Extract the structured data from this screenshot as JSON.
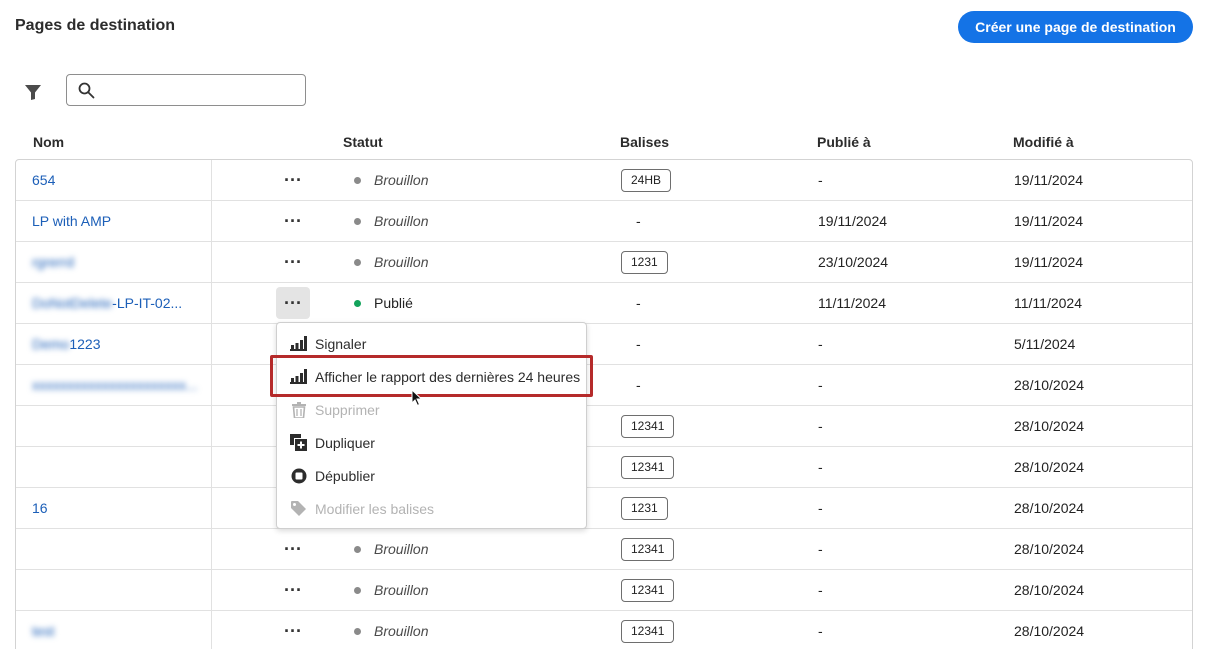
{
  "header": {
    "title": "Pages de destination",
    "create_label": "Créer une page de destination"
  },
  "toolbar": {
    "filter_icon": "filter-icon",
    "search_icon": "search-icon",
    "search_value": "",
    "search_placeholder": ""
  },
  "columns": {
    "name": "Nom",
    "status": "Statut",
    "tags": "Balises",
    "published": "Publié à",
    "modified": "Modifié à"
  },
  "rows": [
    {
      "name": "654",
      "name_suffix": "",
      "blurred": false,
      "status": "Brouillon",
      "tag": "24HB",
      "published": "-",
      "modified": "19/11/2024"
    },
    {
      "name": "LP with AMP",
      "name_suffix": "",
      "blurred": false,
      "status": "Brouillon",
      "tag": "-",
      "published": "19/11/2024",
      "modified": "19/11/2024"
    },
    {
      "name": "rgrerrd",
      "name_suffix": "",
      "blurred": true,
      "status": "Brouillon",
      "tag": "1231",
      "published": "23/10/2024",
      "modified": "19/11/2024"
    },
    {
      "name": "DoNotDelete",
      "name_suffix": "-LP-IT-02...",
      "blurred": true,
      "status": "Publié",
      "tag": "-",
      "published": "11/11/2024",
      "modified": "11/11/2024"
    },
    {
      "name": "Demo",
      "name_suffix": "1223",
      "blurred": true,
      "status": "",
      "tag": "-",
      "published": "-",
      "modified": "5/11/2024"
    },
    {
      "name": "xxxxxxxxxxxxxxxxxxxxxx...",
      "name_suffix": "",
      "blurred": true,
      "status": "",
      "tag": "-",
      "published": "-",
      "modified": "28/10/2024"
    },
    {
      "name": "",
      "name_suffix": "",
      "blurred": false,
      "status": "",
      "tag": "12341",
      "published": "-",
      "modified": "28/10/2024"
    },
    {
      "name": "",
      "name_suffix": "",
      "blurred": false,
      "status": "",
      "tag": "12341",
      "published": "-",
      "modified": "28/10/2024"
    },
    {
      "name": "16",
      "name_suffix": "",
      "blurred": false,
      "status": "",
      "tag": "1231",
      "published": "-",
      "modified": "28/10/2024"
    },
    {
      "name": "",
      "name_suffix": "",
      "blurred": false,
      "status": "Brouillon",
      "tag": "12341",
      "published": "-",
      "modified": "28/10/2024"
    },
    {
      "name": "",
      "name_suffix": "",
      "blurred": false,
      "status": "Brouillon",
      "tag": "12341",
      "published": "-",
      "modified": "28/10/2024"
    },
    {
      "name": "test",
      "name_suffix": "",
      "blurred": true,
      "status": "Brouillon",
      "tag": "12341",
      "published": "-",
      "modified": "28/10/2024"
    }
  ],
  "context_menu": {
    "items": [
      {
        "label": "Signaler",
        "icon": "bar-chart-icon",
        "disabled": false
      },
      {
        "label": "Afficher le rapport des dernières 24 heures",
        "icon": "bar-chart-icon",
        "disabled": false
      },
      {
        "label": "Supprimer",
        "icon": "trash-icon",
        "disabled": true
      },
      {
        "label": "Dupliquer",
        "icon": "duplicate-icon",
        "disabled": false
      },
      {
        "label": "Dépublier",
        "icon": "unpublish-icon",
        "disabled": false
      },
      {
        "label": "Modifier les balises",
        "icon": "tag-icon",
        "disabled": true
      }
    ]
  },
  "colors": {
    "accent": "#1473e6",
    "link": "#1c5fb8",
    "published_dot": "#12a35b",
    "draft_dot": "#8a8a8a",
    "highlight_border": "#b52a2a"
  }
}
